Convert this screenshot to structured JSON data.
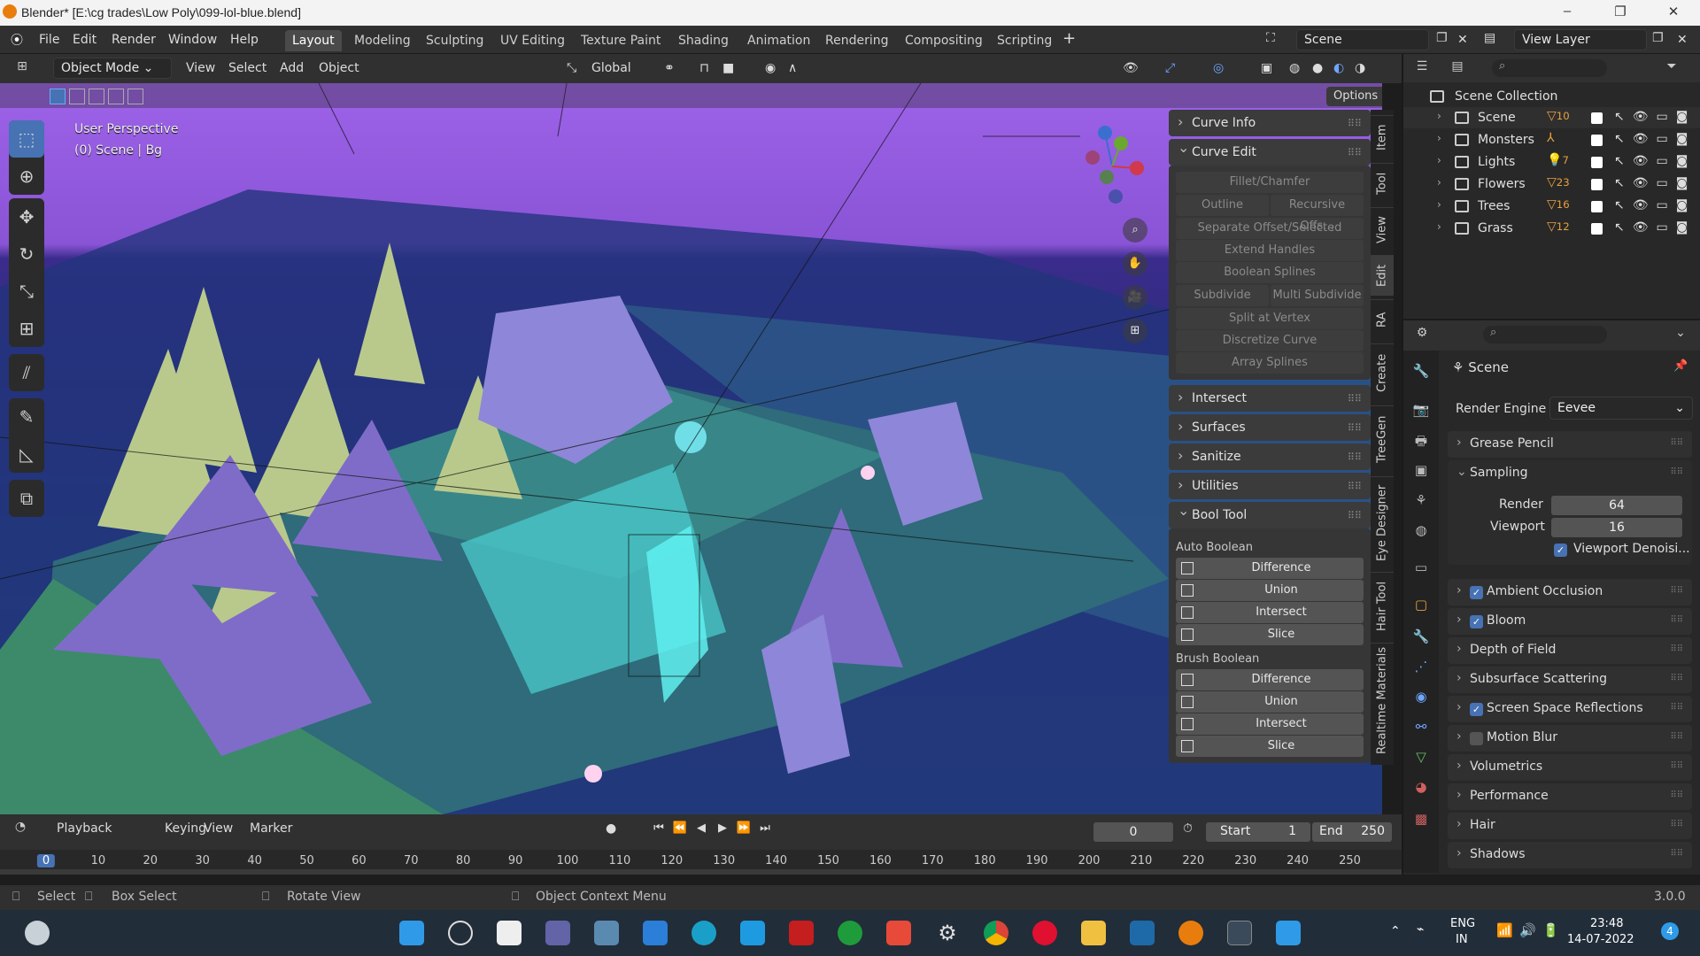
{
  "window": {
    "title": "Blender* [E:\\cg trades\\Low Poly\\099-lol-blue.blend]"
  },
  "menu": [
    "File",
    "Edit",
    "Render",
    "Window",
    "Help"
  ],
  "workspaces": [
    "Layout",
    "Modeling",
    "Sculpting",
    "UV Editing",
    "Texture Paint",
    "Shading",
    "Animation",
    "Rendering",
    "Compositing",
    "Scripting"
  ],
  "scene_field": "Scene",
  "viewlayer_field": "View Layer",
  "viewport_header": {
    "mode": "Object Mode",
    "view": "View",
    "select": "Select",
    "add": "Add",
    "object": "Object",
    "orientation": "Global",
    "options": "Options"
  },
  "viewport": {
    "perspective": "User Perspective",
    "context": "(0) Scene | Bg"
  },
  "npanel": {
    "curve_info": "Curve Info",
    "curve_edit": "Curve Edit",
    "curve_edit_buttons": [
      "Fillet/Chamfer"
    ],
    "outline": "Outline",
    "recursive": "Recursive Offs...",
    "separate": "Separate Offset/Selected",
    "extend": "Extend Handles",
    "boolean_splines": "Boolean Splines",
    "subdivide": "Subdivide",
    "multi_subdivide": "Multi Subdivide",
    "split": "Split at Vertex",
    "discretize": "Discretize Curve",
    "array": "Array Splines",
    "intersect": "Intersect",
    "surfaces": "Surfaces",
    "sanitize": "Sanitize",
    "utilities": "Utilities",
    "bool_tool": "Bool Tool",
    "auto_boolean": "Auto Boolean",
    "brush_boolean": "Brush Boolean",
    "auto_ops": [
      "Difference",
      "Union",
      "Intersect",
      "Slice"
    ],
    "brush_ops": [
      "Difference",
      "Union",
      "Intersect",
      "Slice"
    ]
  },
  "side_tabs": [
    "Item",
    "Tool",
    "View",
    "Edit",
    "RA",
    "Create",
    "TreeGen",
    "Eye Designer",
    "Hair Tool",
    "Realtime Materials"
  ],
  "outliner": {
    "root": "Scene Collection",
    "items": [
      {
        "name": "Scene",
        "count": "10"
      },
      {
        "name": "Monsters",
        "count": ""
      },
      {
        "name": "Lights",
        "count": "7"
      },
      {
        "name": "Flowers",
        "count": "23"
      },
      {
        "name": "Trees",
        "count": "16"
      },
      {
        "name": "Grass",
        "count": "12"
      }
    ]
  },
  "properties": {
    "scene": "Scene",
    "render_engine_label": "Render Engine",
    "render_engine": "Eevee",
    "grease_pencil": "Grease Pencil",
    "sampling": "Sampling",
    "render_label": "Render",
    "render_value": "64",
    "viewport_label": "Viewport",
    "viewport_value": "16",
    "denoise": "Viewport Denoisi...",
    "sections": [
      {
        "label": "Ambient Occlusion",
        "checkbox": true,
        "checked": true
      },
      {
        "label": "Bloom",
        "checkbox": true,
        "checked": true
      },
      {
        "label": "Depth of Field",
        "checkbox": false
      },
      {
        "label": "Subsurface Scattering",
        "checkbox": false
      },
      {
        "label": "Screen Space Reflections",
        "checkbox": true,
        "checked": true
      },
      {
        "label": "Motion Blur",
        "checkbox": true,
        "checked": false
      },
      {
        "label": "Volumetrics",
        "checkbox": false
      },
      {
        "label": "Performance",
        "checkbox": false
      },
      {
        "label": "Hair",
        "checkbox": false
      },
      {
        "label": "Shadows",
        "checkbox": false
      }
    ]
  },
  "timeline": {
    "playback": "Playback",
    "keying": "Keying",
    "view": "View",
    "marker": "Marker",
    "current": "0",
    "start_label": "Start",
    "start": "1",
    "end_label": "End",
    "end": "250",
    "ticks": [
      "0",
      "10",
      "20",
      "30",
      "40",
      "50",
      "60",
      "70",
      "80",
      "90",
      "100",
      "110",
      "120",
      "130",
      "140",
      "150",
      "160",
      "170",
      "180",
      "190",
      "200",
      "210",
      "220",
      "230",
      "240",
      "250"
    ]
  },
  "statusbar": {
    "select": "Select",
    "box_select": "Box Select",
    "rotate": "Rotate View",
    "context_menu": "Object Context Menu",
    "version": "3.0.0"
  },
  "taskbar": {
    "lang1": "ENG",
    "lang2": "IN",
    "time": "23:48",
    "date": "14-07-2022",
    "notif": "4"
  }
}
